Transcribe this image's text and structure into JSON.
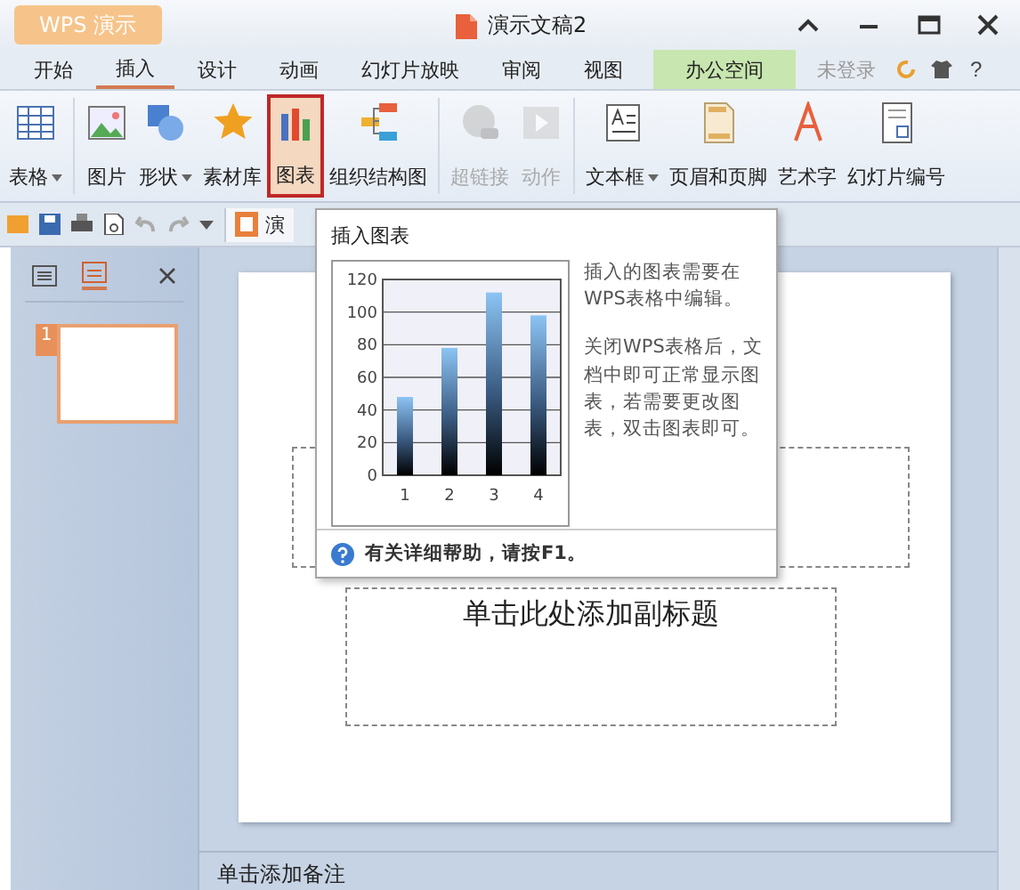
{
  "window": {
    "app_button": "WPS 演示",
    "title": "演示文稿2"
  },
  "menu_tabs": [
    {
      "label": "开始",
      "selected": false,
      "kind": "tab"
    },
    {
      "label": "插入",
      "selected": true,
      "kind": "tab"
    },
    {
      "label": "设计",
      "selected": false,
      "kind": "tab"
    },
    {
      "label": "动画",
      "selected": false,
      "kind": "tab"
    },
    {
      "label": "幻灯片放映",
      "selected": false,
      "kind": "tab"
    },
    {
      "label": "审阅",
      "selected": false,
      "kind": "tab"
    },
    {
      "label": "视图",
      "selected": false,
      "kind": "tab"
    },
    {
      "label": "办公空间",
      "selected": false,
      "kind": "highlight"
    }
  ],
  "login": "未登录",
  "help_button": "?",
  "ribbon": {
    "groups": [
      [
        {
          "label": "表格",
          "selected": false,
          "disabled": false,
          "dropdown": true
        }
      ],
      [
        {
          "label": "图片",
          "selected": false,
          "disabled": false,
          "dropdown": false
        },
        {
          "label": "形状",
          "selected": false,
          "disabled": false,
          "dropdown": true
        },
        {
          "label": "素材库",
          "selected": false,
          "disabled": false,
          "dropdown": false
        },
        {
          "label": "图表",
          "selected": true,
          "disabled": false,
          "dropdown": false
        },
        {
          "label": "组织结构图",
          "selected": false,
          "disabled": false,
          "dropdown": false
        }
      ],
      [
        {
          "label": "超链接",
          "selected": false,
          "disabled": true,
          "dropdown": false
        },
        {
          "label": "动作",
          "selected": false,
          "disabled": true,
          "dropdown": false
        }
      ],
      [
        {
          "label": "文本框",
          "selected": false,
          "disabled": false,
          "dropdown": true
        },
        {
          "label": "页眉和页脚",
          "selected": false,
          "disabled": false,
          "dropdown": false
        },
        {
          "label": "艺术字",
          "selected": false,
          "disabled": false,
          "dropdown": false
        },
        {
          "label": "幻灯片编号",
          "selected": false,
          "disabled": false,
          "dropdown": false
        }
      ]
    ]
  },
  "quick_access": {
    "doc_tab": "演"
  },
  "slide_panel": {
    "slides": [
      {
        "number": "1",
        "selected": true
      }
    ]
  },
  "slide": {
    "subtitle_placeholder": "单击此处添加副标题"
  },
  "tooltip": {
    "title": "插入图表",
    "chart_data": {
      "type": "bar",
      "categories": [
        "1",
        "2",
        "3",
        "4"
      ],
      "values": [
        48,
        78,
        112,
        98
      ],
      "ylim": [
        0,
        120
      ],
      "yticks": [
        0,
        20,
        40,
        60,
        80,
        100,
        120
      ],
      "grid": true
    },
    "paragraphs": [
      "插入的图表需要在WPS表格中编辑。",
      "关闭WPS表格后，文档中即可正常显示图表，若需要更改图表，双击图表即可。"
    ],
    "help": "有关详细帮助，请按F1。"
  },
  "notes": {
    "placeholder": "单击添加备注"
  }
}
